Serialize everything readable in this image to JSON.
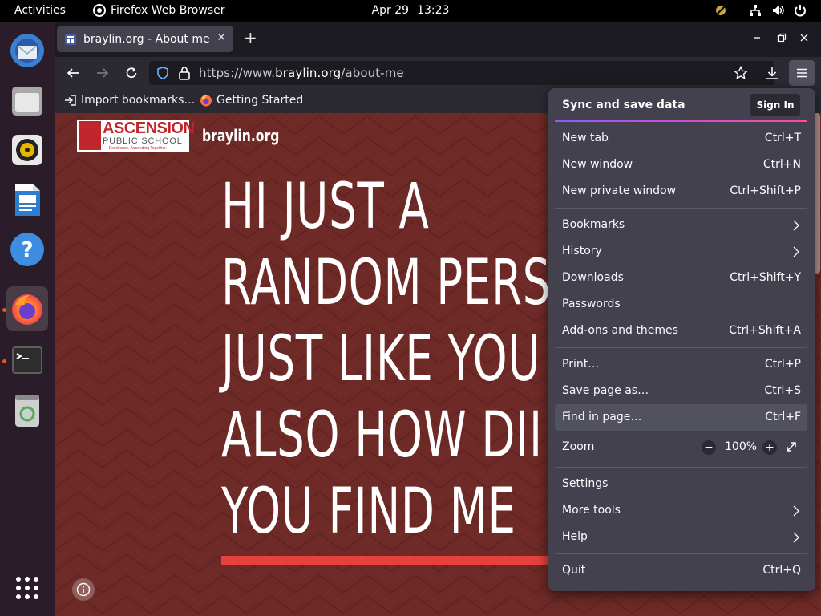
{
  "topbar": {
    "activities": "Activities",
    "app_name": "Firefox Web Browser",
    "date": "Apr 29",
    "time": "13:23"
  },
  "dock": {
    "items": [
      {
        "name": "thunderbird",
        "icon": "mail-icon"
      },
      {
        "name": "files",
        "icon": "folder-icon"
      },
      {
        "name": "rhythmbox",
        "icon": "speaker-icon"
      },
      {
        "name": "writer",
        "icon": "document-icon"
      },
      {
        "name": "help",
        "icon": "help-icon"
      },
      {
        "name": "firefox",
        "icon": "firefox-icon",
        "active": true
      },
      {
        "name": "terminal",
        "icon": "terminal-icon"
      },
      {
        "name": "trash",
        "icon": "recycle-icon"
      },
      {
        "name": "app-grid",
        "icon": "grid-icon"
      }
    ]
  },
  "browser": {
    "tab_title": "braylin.org - About me",
    "url_prefix": "https://www.",
    "url_host": "braylin.org",
    "url_path": "/about-me",
    "bookmarks": [
      {
        "label": "Import bookmarks…",
        "icon": "import-icon"
      },
      {
        "label": "Getting Started",
        "icon": "firefox-icon"
      }
    ]
  },
  "page": {
    "logo_line1": "ASCENSION",
    "logo_line2": "PUBLIC SCHOOL",
    "logo_line3": "Excellence. Ascending Together.",
    "site_name": "braylin.org",
    "hero_lines": [
      "HI JUST A",
      "RANDOM PERS",
      "JUST LIKE YOU",
      "ALSO HOW DII",
      "YOU FIND ME"
    ],
    "colors": {
      "background": "#6e2a26",
      "accent": "#e8403d"
    }
  },
  "menu": {
    "sync_title": "Sync and save data",
    "sign_in": "Sign In",
    "new_tab": {
      "label": "New tab",
      "shortcut": "Ctrl+T"
    },
    "new_window": {
      "label": "New window",
      "shortcut": "Ctrl+N"
    },
    "new_private": {
      "label": "New private window",
      "shortcut": "Ctrl+Shift+P"
    },
    "bookmarks": {
      "label": "Bookmarks"
    },
    "history": {
      "label": "History"
    },
    "downloads": {
      "label": "Downloads",
      "shortcut": "Ctrl+Shift+Y"
    },
    "passwords": {
      "label": "Passwords"
    },
    "addons": {
      "label": "Add-ons and themes",
      "shortcut": "Ctrl+Shift+A"
    },
    "print": {
      "label": "Print…",
      "shortcut": "Ctrl+P"
    },
    "save_page": {
      "label": "Save page as…",
      "shortcut": "Ctrl+S"
    },
    "find": {
      "label": "Find in page…",
      "shortcut": "Ctrl+F"
    },
    "zoom": {
      "label": "Zoom",
      "minus": "−",
      "value": "100%",
      "plus": "+"
    },
    "settings": {
      "label": "Settings"
    },
    "more_tools": {
      "label": "More tools"
    },
    "help": {
      "label": "Help"
    },
    "quit": {
      "label": "Quit",
      "shortcut": "Ctrl+Q"
    }
  }
}
